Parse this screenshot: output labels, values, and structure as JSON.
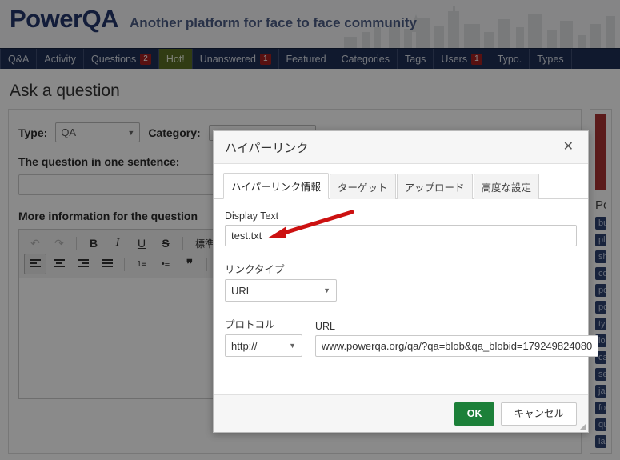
{
  "header": {
    "logo": "PowerQA",
    "slogan": "Another platform for face to face community"
  },
  "nav": {
    "items": [
      {
        "label": "Q&A",
        "badge": null,
        "highlight": false
      },
      {
        "label": "Activity",
        "badge": null,
        "highlight": false
      },
      {
        "label": "Questions",
        "badge": "2",
        "highlight": false
      },
      {
        "label": "Hot!",
        "badge": null,
        "highlight": true
      },
      {
        "label": "Unanswered",
        "badge": "1",
        "highlight": false
      },
      {
        "label": "Featured",
        "badge": null,
        "highlight": false
      },
      {
        "label": "Categories",
        "badge": null,
        "highlight": false
      },
      {
        "label": "Tags",
        "badge": null,
        "highlight": false
      },
      {
        "label": "Users",
        "badge": "1",
        "highlight": false
      },
      {
        "label": "Typo.",
        "badge": null,
        "highlight": false
      },
      {
        "label": "Types",
        "badge": null,
        "highlight": false
      }
    ]
  },
  "page": {
    "title": "Ask a question",
    "type_label": "Type:",
    "type_value": "QA",
    "category_label": "Category:",
    "question_label": "The question in one sentence:",
    "question_value": "",
    "more_info_label": "More information for the question",
    "toolbar": {
      "undo": "↶",
      "redo": "↷",
      "bold": "B",
      "italic": "I",
      "underline": "U",
      "strike": "S",
      "format": "標準",
      "align_left": "▤",
      "align_center": "▤",
      "align_right": "▤",
      "align_justify": "▤",
      "numbered_list": "1≡",
      "bulleted_list": "•≡",
      "blockquote": "❞",
      "image": "▣"
    }
  },
  "sidebar": {
    "heading": "Po",
    "alert_text": "",
    "tags": [
      "bu",
      "pl",
      "sh",
      "co",
      "po",
      "po",
      "ty",
      "lo",
      "ca",
      "se",
      "ja",
      "fo",
      "qu",
      "la"
    ]
  },
  "dialog": {
    "title": "ハイパーリンク",
    "close_icon": "✕",
    "tabs": [
      {
        "label": "ハイパーリンク情報",
        "selected": true
      },
      {
        "label": "ターゲット",
        "selected": false
      },
      {
        "label": "アップロード",
        "selected": false
      },
      {
        "label": "高度な設定",
        "selected": false
      }
    ],
    "display_text_label": "Display Text",
    "display_text_value": "test.txt",
    "link_type_label": "リンクタイプ",
    "link_type_value": "URL",
    "protocol_label": "プロトコル",
    "protocol_value": "http://",
    "url_label": "URL",
    "url_value": "www.powerqa.org/qa/?qa=blob&qa_blobid=179249824080",
    "ok_label": "OK",
    "cancel_label": "キャンセル",
    "caret": "▼"
  },
  "annotation": {
    "arrow_color": "#cc1111"
  },
  "colors": {
    "nav_bg": "#1f2f56",
    "hot_bg": "#5c7023",
    "badge_bg": "#a32020",
    "logo": "#23366b",
    "ok_green": "#1c8039"
  }
}
